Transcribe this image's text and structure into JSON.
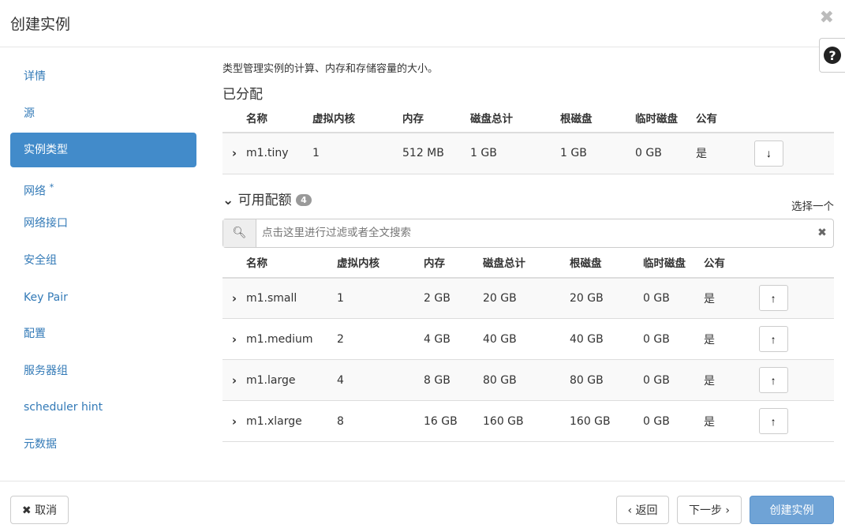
{
  "header": {
    "title": "创建实例",
    "close_icon": "close-icon",
    "help_icon": "question-circle-icon"
  },
  "sidebar": {
    "items": [
      {
        "label": "详情"
      },
      {
        "label": "源"
      },
      {
        "label": "实例类型"
      },
      {
        "label": "网络",
        "required": "*"
      },
      {
        "label": "网络接口"
      },
      {
        "label": "安全组"
      },
      {
        "label": "Key Pair"
      },
      {
        "label": "配置"
      },
      {
        "label": "服务器组"
      },
      {
        "label": "scheduler hint"
      },
      {
        "label": "元数据"
      }
    ]
  },
  "main": {
    "description": "类型管理实例的计算、内存和存储容量的大小。",
    "allocated_title": "已分配",
    "columns": [
      "名称",
      "虚拟内核",
      "内存",
      "磁盘总计",
      "根磁盘",
      "临时磁盘",
      "公有"
    ],
    "allocated": [
      [
        "m1.tiny",
        "1",
        "512 MB",
        "1 GB",
        "1 GB",
        "0 GB",
        "是"
      ]
    ],
    "available_title": "可用配额",
    "available_count": "4",
    "pick_one": "选择一个",
    "search_placeholder": "点击这里进行过滤或者全文搜索",
    "available": [
      [
        "m1.small",
        "1",
        "2 GB",
        "20 GB",
        "20 GB",
        "0 GB",
        "是"
      ],
      [
        "m1.medium",
        "2",
        "4 GB",
        "40 GB",
        "40 GB",
        "0 GB",
        "是"
      ],
      [
        "m1.large",
        "4",
        "8 GB",
        "80 GB",
        "80 GB",
        "0 GB",
        "是"
      ],
      [
        "m1.xlarge",
        "8",
        "16 GB",
        "160 GB",
        "160 GB",
        "0 GB",
        "是"
      ]
    ]
  },
  "footer": {
    "cancel": "✖ 取消",
    "back": "‹ 返回",
    "next": "下一步 ›",
    "create": "创建实例"
  }
}
